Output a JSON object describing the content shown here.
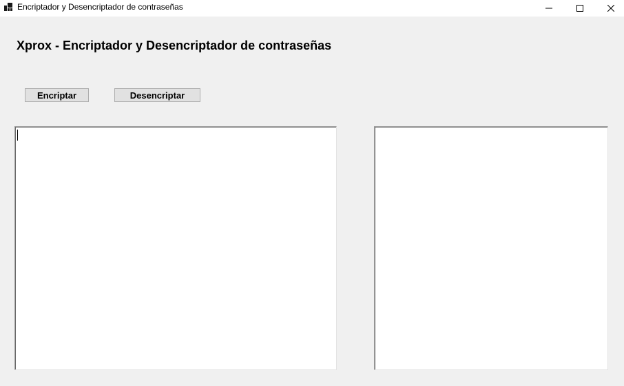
{
  "window": {
    "title": "Encriptador y Desencriptador de contraseñas",
    "controls": {
      "minimize_icon": "minimize-icon",
      "maximize_icon": "maximize-icon",
      "close_icon": "close-icon"
    }
  },
  "form": {
    "title": "Xprox - Encriptador y Desencriptador de contraseñas",
    "buttons": {
      "encrypt_label": "Encriptar",
      "decrypt_label": "Desencriptar"
    },
    "input_text": "",
    "output_text": ""
  },
  "colors": {
    "window_background": "#f0f0f0",
    "titlebar_background": "#ffffff",
    "button_background": "#e1e1e1",
    "button_border": "#adadad",
    "textbox_background": "#ffffff"
  }
}
